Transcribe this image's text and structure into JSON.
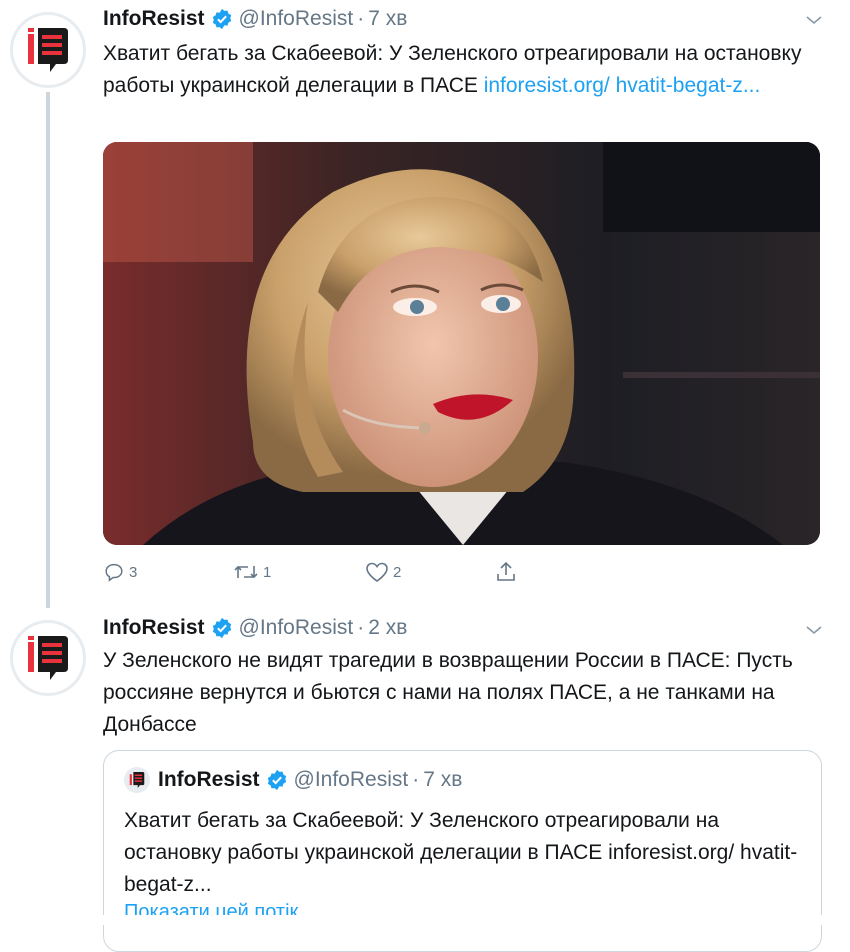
{
  "tweets": [
    {
      "name": "InfoResist",
      "handle": "@InfoResist",
      "sep": "·",
      "time": "7 хв",
      "text": "Хватит бегать за Скабеевой: У Зеленского отреагировали на остановку работы украинской делегации в ПАСЕ ",
      "link": "inforesist.org/ hvatit-begat-z...",
      "actions": {
        "replies": "3",
        "retweets": "1",
        "likes": "2"
      }
    },
    {
      "name": "InfoResist",
      "handle": "@InfoResist",
      "sep": "·",
      "time": "2 хв",
      "text": "У Зеленского не видят трагедии в возвращении России в ПАСЕ: Пусть россияне вернутся и бьются с нами на полях ПАСЕ, а не танками на Донбассе"
    }
  ],
  "quote": {
    "name": "InfoResist",
    "handle": "@InfoResist",
    "sep": "·",
    "time": "7 хв",
    "text": "Хватит бегать за Скабеевой: У Зеленского отреагировали на остановку работы украинской делегации в ПАСЕ inforesist.org/ hvatit-begat-z...",
    "show_thread": "Показати цей потік"
  },
  "colors": {
    "accent": "#1da1f2",
    "secondary": "#657786",
    "brand_red": "#e8323c"
  },
  "icons": [
    "logo-icon",
    "verified-icon",
    "chevron-down-icon",
    "reply-icon",
    "retweet-icon",
    "like-icon",
    "share-icon"
  ]
}
